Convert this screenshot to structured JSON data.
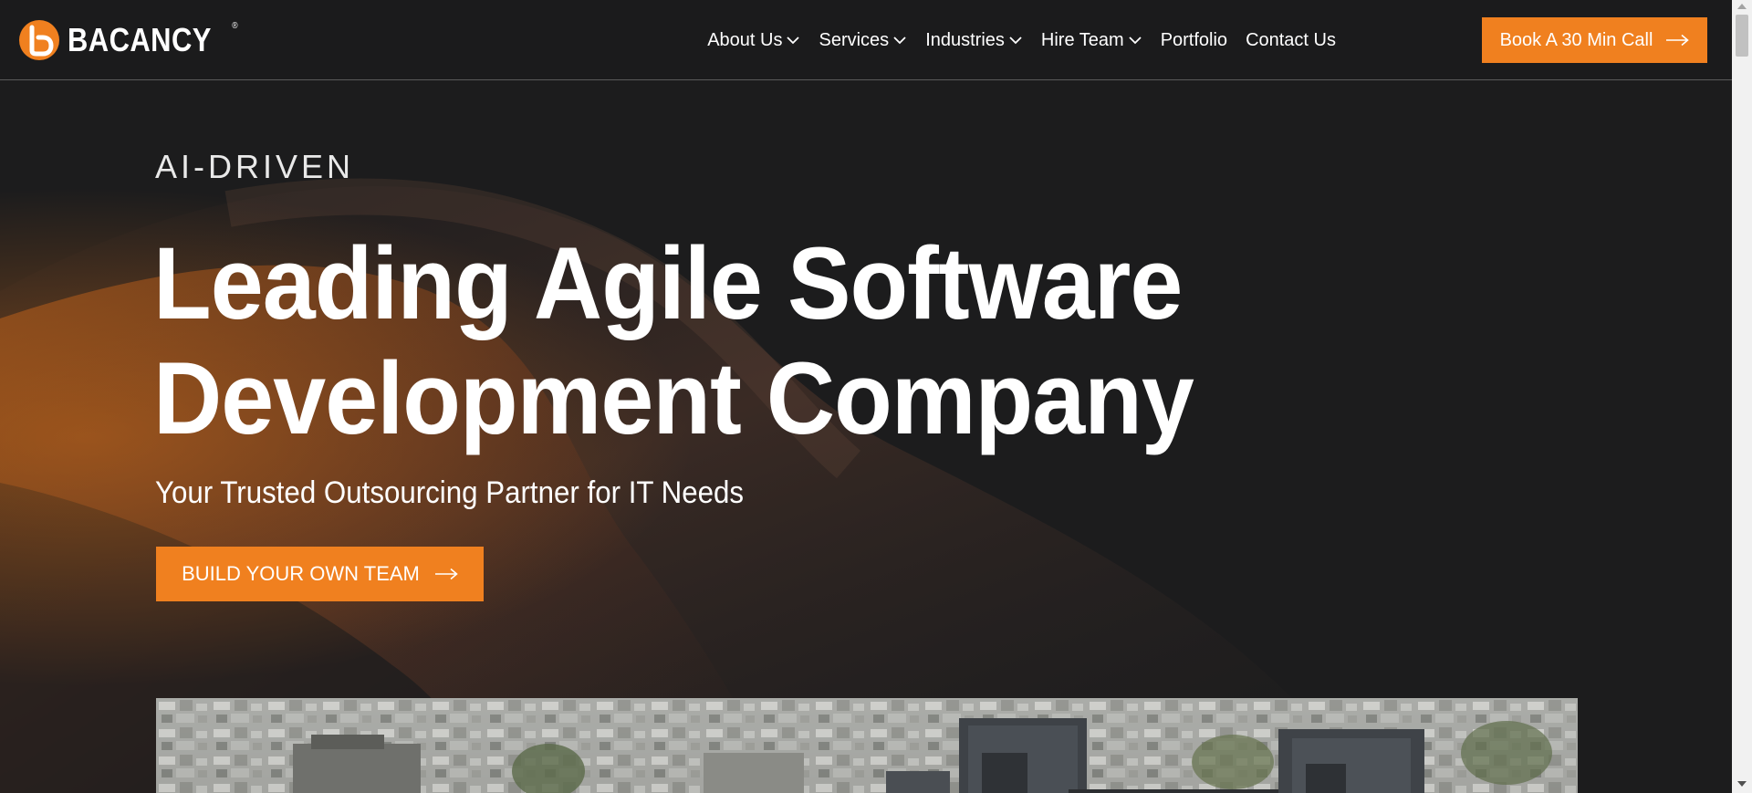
{
  "brand": {
    "name": "BACANCY",
    "registered_mark": "®",
    "accent_color": "#f0801f",
    "background_color": "#1c1c1d"
  },
  "nav": {
    "items": [
      {
        "label": "About Us",
        "has_dropdown": true,
        "icon": "chevron-down-icon"
      },
      {
        "label": "Services",
        "has_dropdown": true,
        "icon": "chevron-down-icon"
      },
      {
        "label": "Industries",
        "has_dropdown": true,
        "icon": "chevron-down-icon"
      },
      {
        "label": "Hire Team",
        "has_dropdown": true,
        "icon": "chevron-down-icon"
      },
      {
        "label": "Portfolio",
        "has_dropdown": false
      },
      {
        "label": "Contact Us",
        "has_dropdown": false
      }
    ],
    "cta_label": "Book A 30 Min Call",
    "cta_icon": "arrow-right-icon"
  },
  "hero": {
    "eyebrow": "AI-DRIVEN",
    "headline_line1": "Leading Agile Software",
    "headline_line2": "Development Company",
    "subheadline": "Your Trusted Outsourcing Partner for IT Needs",
    "button_label": "BUILD YOUR OWN TEAM",
    "button_icon": "arrow-right-icon"
  }
}
